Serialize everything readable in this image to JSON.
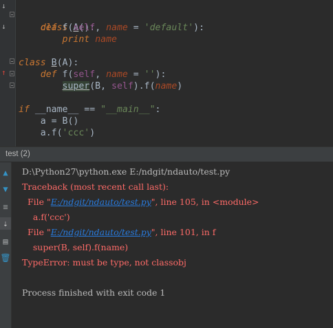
{
  "editor": {
    "line1": {
      "kw": "class",
      "name": "A",
      "rest": "():"
    },
    "line2": {
      "kw": "def",
      "name": " f(",
      "self": "self",
      "sep": ", ",
      "param": "name",
      "eq": " = ",
      "str": "'default'",
      "end": "):"
    },
    "line3": {
      "kw": "print",
      "arg": "name"
    },
    "line5": {
      "kw": "class",
      "name": "B",
      "rest": "(A):"
    },
    "line6": {
      "kw": "def",
      "name": " f(",
      "self": "self",
      "sep": ", ",
      "param": "name",
      "eq": " = ",
      "str": "''",
      "end": "):"
    },
    "line7": {
      "call": "super",
      "open": "(B, ",
      "self": "self",
      "rest": ").f(",
      "arg": "name",
      "end": ")"
    },
    "line9": {
      "kw": "if",
      "name": " __name__ == ",
      "str": "\"__main__\"",
      "end": ":"
    },
    "line10": {
      "text": "a = B()"
    },
    "line11": {
      "pre": "a.f(",
      "str": "'ccc'",
      "end": ")"
    }
  },
  "panel": {
    "tab_label": "test (2)"
  },
  "console": {
    "cmd": "D:\\Python27\\python.exe E:/ndgit/ndauto/test.py",
    "traceback": "Traceback (most recent call last):",
    "frame1_pre": "  File \"",
    "frame1_link": "E:/ndgit/ndauto/test.py",
    "frame1_post": "\", line 105, in <module>",
    "frame1_code": "    a.f('ccc')",
    "frame2_pre": "  File \"",
    "frame2_link": "E:/ndgit/ndauto/test.py",
    "frame2_post": "\", line 101, in f",
    "frame2_code": "    super(B, self).f(name)",
    "error": "TypeError: must be type, not classobj",
    "exit": "Process finished with exit code 1"
  },
  "colors": {
    "background": "#2b2b2b",
    "error": "#ff6b68",
    "link": "#287bde",
    "keyword": "#cc7832",
    "string": "#6a8759",
    "self": "#94558d"
  }
}
